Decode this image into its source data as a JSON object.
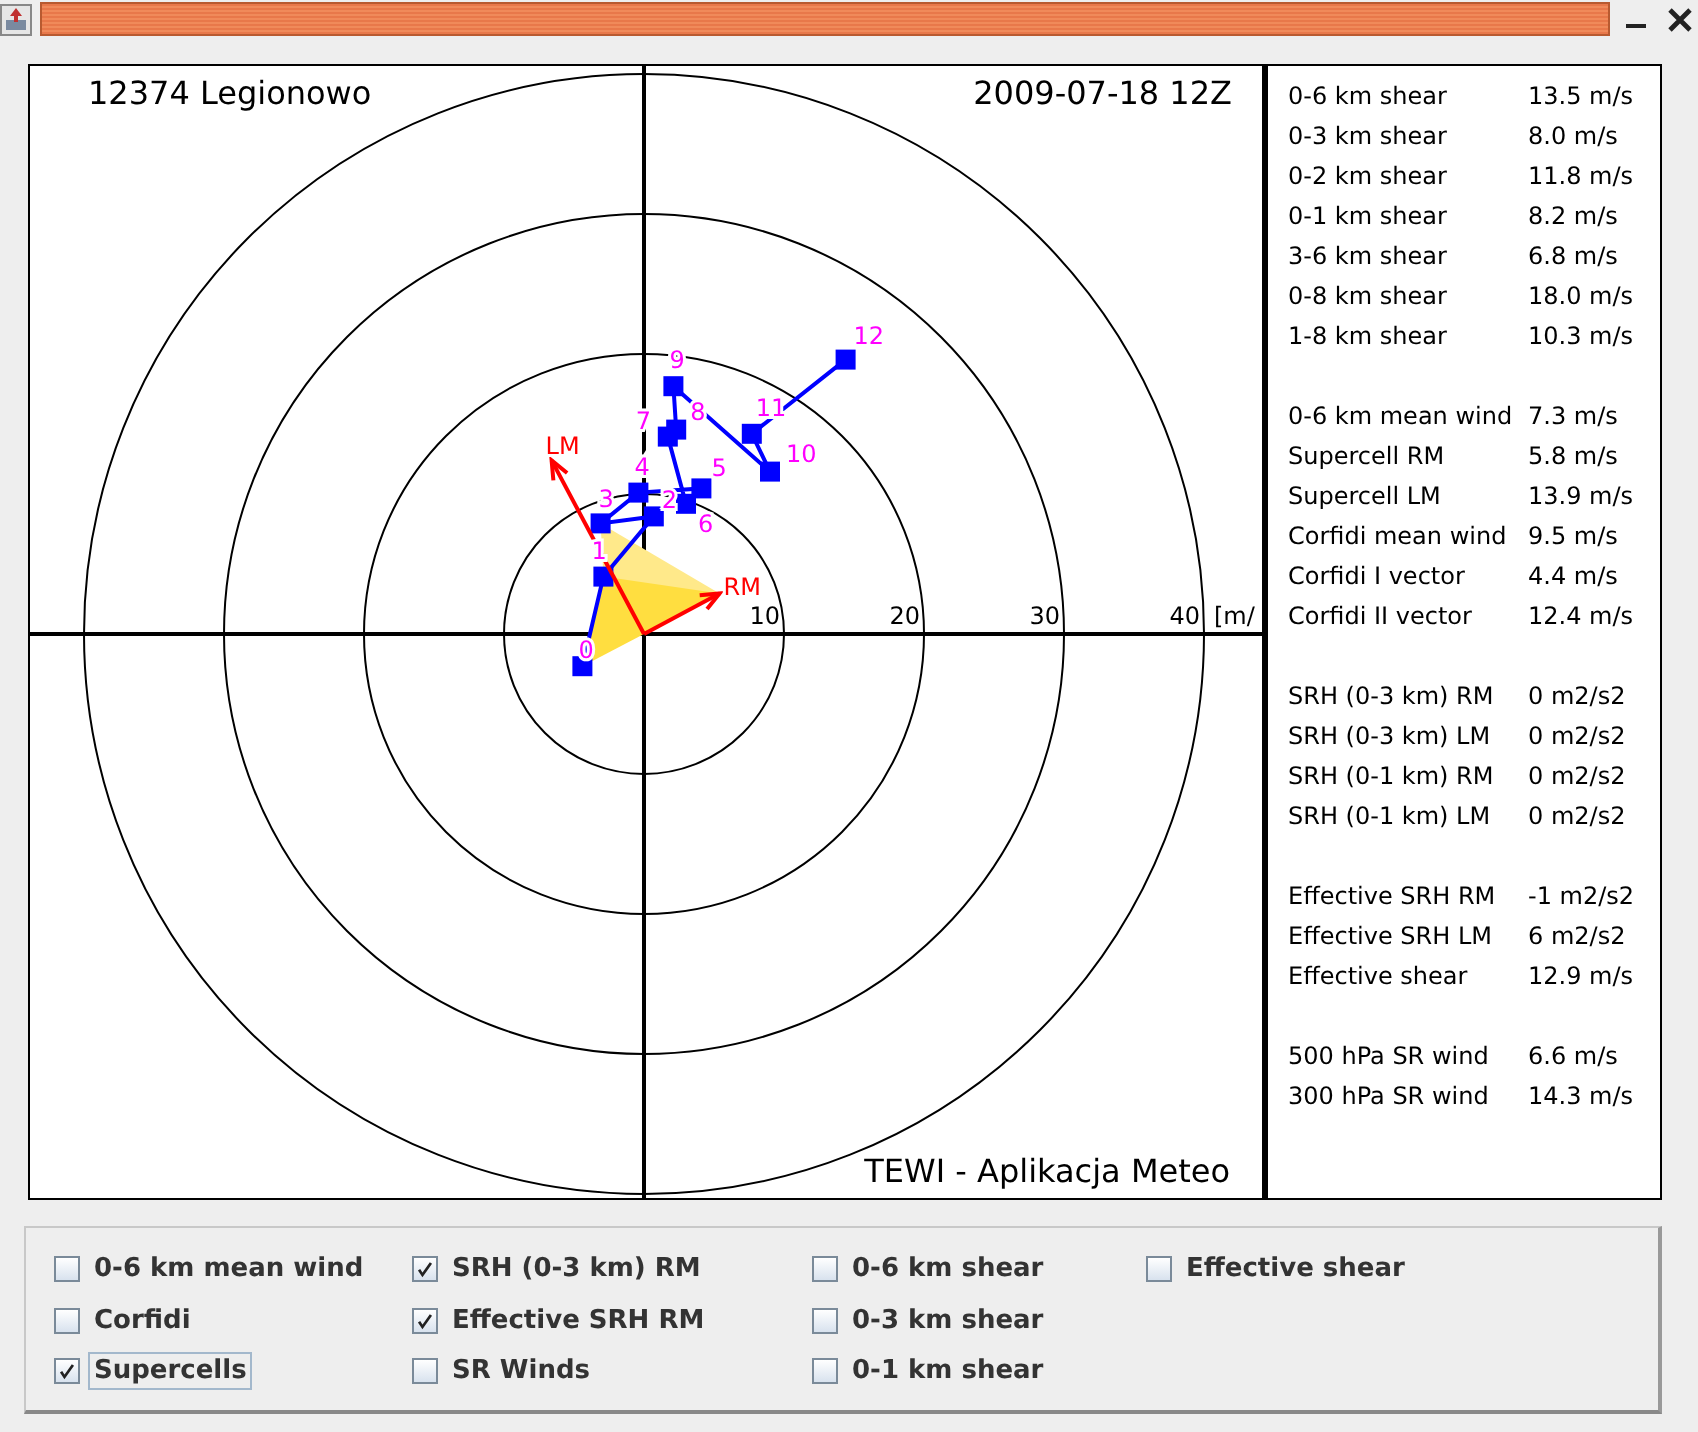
{
  "plot": {
    "station": "12374 Legionowo",
    "date": "2009-07-18 12Z",
    "footer": "TEWI - Aplikacja Meteo",
    "hodograph": {
      "ring_labels": [
        "10",
        "20",
        "30",
        "40"
      ],
      "unit": "[m/",
      "points": [
        {
          "label": "0"
        },
        {
          "label": "1"
        },
        {
          "label": "2"
        },
        {
          "label": "3"
        },
        {
          "label": "4"
        },
        {
          "label": "5"
        },
        {
          "label": "6"
        },
        {
          "label": "7"
        },
        {
          "label": "8"
        },
        {
          "label": "9"
        },
        {
          "label": "10"
        },
        {
          "label": "11"
        },
        {
          "label": "12"
        }
      ],
      "vectors": [
        {
          "label": "LM"
        },
        {
          "label": "RM"
        }
      ]
    }
  },
  "stats": [
    [
      {
        "label": "0-6 km shear",
        "value": "13.5 m/s"
      },
      {
        "label": "0-3 km shear",
        "value": "8.0 m/s"
      },
      {
        "label": "0-2 km shear",
        "value": "11.8 m/s"
      },
      {
        "label": "0-1 km shear",
        "value": "8.2 m/s"
      },
      {
        "label": "3-6 km shear",
        "value": "6.8 m/s"
      },
      {
        "label": "0-8 km shear",
        "value": "18.0 m/s"
      },
      {
        "label": "1-8 km shear",
        "value": "10.3 m/s"
      }
    ],
    [
      {
        "label": "0-6 km mean wind",
        "value": "7.3 m/s"
      },
      {
        "label": "Supercell RM",
        "value": "5.8 m/s"
      },
      {
        "label": "Supercell LM",
        "value": "13.9 m/s"
      },
      {
        "label": "Corfidi mean wind",
        "value": "9.5 m/s"
      },
      {
        "label": "Corfidi I vector",
        "value": "4.4 m/s"
      },
      {
        "label": "Corfidi II vector",
        "value": "12.4 m/s"
      }
    ],
    [
      {
        "label": "SRH (0-3 km) RM",
        "value": "0 m2/s2"
      },
      {
        "label": "SRH (0-3 km) LM",
        "value": "0 m2/s2"
      },
      {
        "label": "SRH (0-1 km) RM",
        "value": "0 m2/s2"
      },
      {
        "label": "SRH (0-1 km) LM",
        "value": "0 m2/s2"
      }
    ],
    [
      {
        "label": "Effective SRH RM",
        "value": "-1 m2/s2"
      },
      {
        "label": "Effective SRH LM",
        "value": "6 m2/s2"
      },
      {
        "label": "Effective shear",
        "value": "12.9 m/s"
      }
    ],
    [
      {
        "label": "500 hPa SR wind",
        "value": "6.6 m/s"
      },
      {
        "label": "300 hPa SR wind",
        "value": "14.3 m/s"
      }
    ]
  ],
  "options": [
    {
      "label": "0-6 km mean wind",
      "checked": false,
      "focused": false
    },
    {
      "label": "Corfidi",
      "checked": false,
      "focused": false
    },
    {
      "label": "Supercells",
      "checked": true,
      "focused": true
    },
    {
      "label": "SRH (0-3 km) RM",
      "checked": true,
      "focused": false
    },
    {
      "label": "Effective SRH RM",
      "checked": true,
      "focused": false
    },
    {
      "label": "SR Winds",
      "checked": false,
      "focused": false
    },
    {
      "label": "0-6 km shear",
      "checked": false,
      "focused": false
    },
    {
      "label": "0-3 km shear",
      "checked": false,
      "focused": false
    },
    {
      "label": "0-1 km shear",
      "checked": false,
      "focused": false
    },
    {
      "label": "Effective shear",
      "checked": false,
      "focused": false
    }
  ]
}
